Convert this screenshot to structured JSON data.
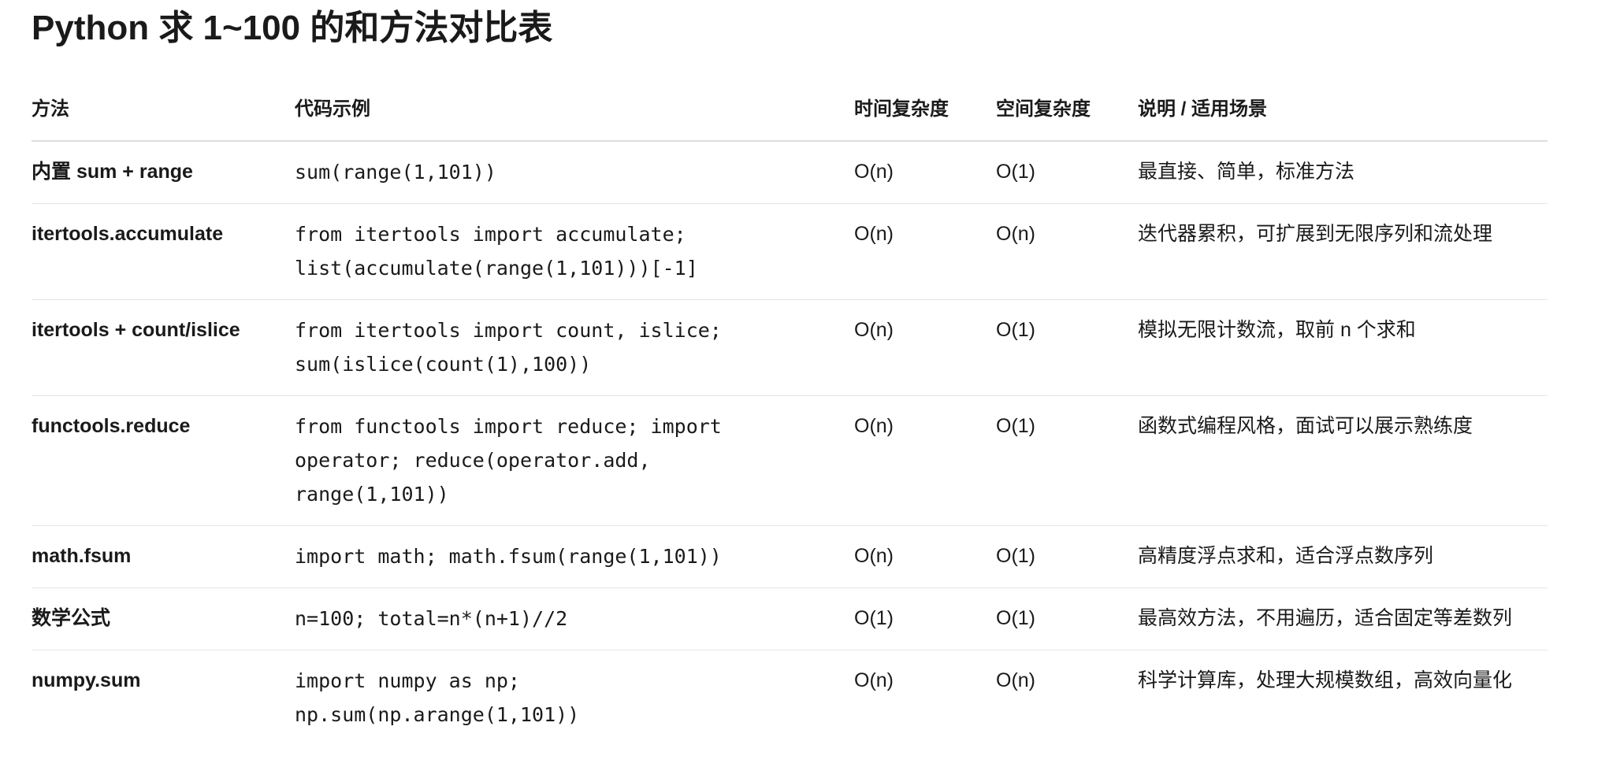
{
  "title": "Python 求 1~100 的和方法对比表",
  "table": {
    "headers": [
      "方法",
      "代码示例",
      "时间复杂度",
      "空间复杂度",
      "说明 / 适用场景"
    ],
    "rows": [
      {
        "method": "内置 sum + range",
        "code": "sum(range(1,101))",
        "time": "O(n)",
        "space": "O(1)",
        "note": "最直接、简单，标准方法"
      },
      {
        "method": "itertools.accumulate",
        "code": "from itertools import accumulate;\nlist(accumulate(range(1,101)))[-1]",
        "time": "O(n)",
        "space": "O(n)",
        "note": "迭代器累积，可扩展到无限序列和流处理"
      },
      {
        "method": "itertools + count/islice",
        "code": "from itertools import count, islice;\nsum(islice(count(1),100))",
        "time": "O(n)",
        "space": "O(1)",
        "note": "模拟无限计数流，取前 n 个求和"
      },
      {
        "method": "functools.reduce",
        "code": "from functools import reduce; import\noperator; reduce(operator.add,\nrange(1,101))",
        "time": "O(n)",
        "space": "O(1)",
        "note": "函数式编程风格，面试可以展示熟练度"
      },
      {
        "method": "math.fsum",
        "code": "import math; math.fsum(range(1,101))",
        "time": "O(n)",
        "space": "O(1)",
        "note": "高精度浮点求和，适合浮点数序列"
      },
      {
        "method": "数学公式",
        "code": "n=100; total=n*(n+1)//2",
        "time": "O(1)",
        "space": "O(1)",
        "note": "最高效方法，不用遍历，适合固定等差数列"
      },
      {
        "method": "numpy.sum",
        "code": "import numpy as np;\nnp.sum(np.arange(1,101))",
        "time": "O(n)",
        "space": "O(n)",
        "note": "科学计算库，处理大规模数组，高效向量化"
      }
    ]
  }
}
